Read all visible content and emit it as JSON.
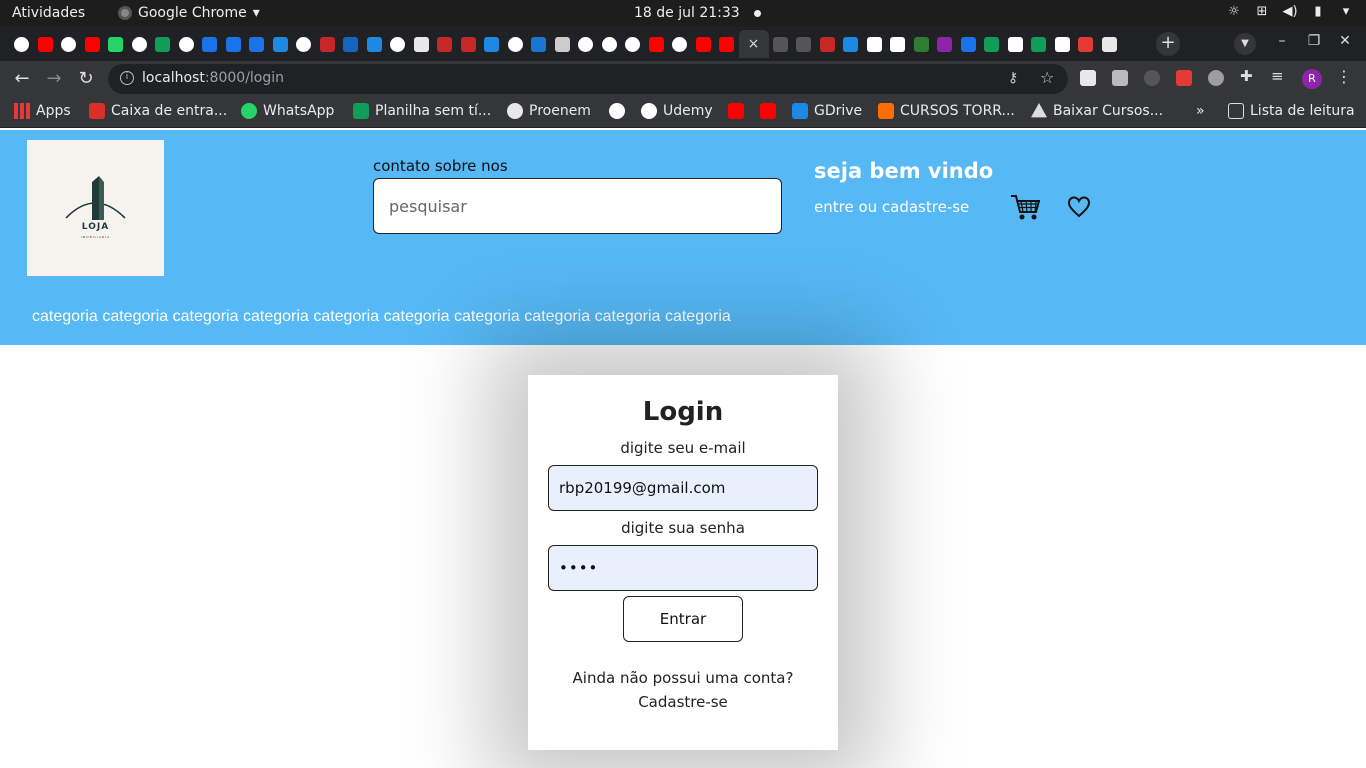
{
  "os": {
    "activities": "Atividades",
    "app_name": "Google Chrome",
    "app_arrow": "▾",
    "datetime": "18 de jul  21:33"
  },
  "browser": {
    "url_host": "localhost",
    "url_path": ":8000/login",
    "tab_close": "×",
    "bookmarks": {
      "apps": "Apps",
      "gmail": "Caixa de entra...",
      "whatsapp": "WhatsApp",
      "sheets": "Planilha sem tí...",
      "proenem": "Proenem",
      "udemy": "Udemy",
      "gdrive": "GDrive",
      "cursos": "CURSOS TORR...",
      "baixar": "Baixar Cursos...",
      "reading_list": "Lista de leitura"
    },
    "profile_initial": "R"
  },
  "site": {
    "logo_text": "LOJA",
    "logo_subtext": "IMOBILIÁRIA",
    "nav_links": "contato sobre nos",
    "search_placeholder": "pesquisar",
    "welcome": "seja bem vindo",
    "login_link": "entre ou cadastre-se",
    "categories": [
      "categoria",
      "categoria",
      "categoria",
      "categoria",
      "categoria",
      "categoria",
      "categoria",
      "categoria",
      "categoria",
      "categoria"
    ],
    "colors": {
      "header_bg": "#56b8f4",
      "input_autofill_bg": "#e8f0fe"
    }
  },
  "login": {
    "title": "Login",
    "email_label": "digite seu e-mail",
    "email_value": "rbp20199@gmail.com",
    "password_label": "digite sua senha",
    "password_value": "••••",
    "submit_label": "Entrar",
    "no_account": "Ainda não possui uma conta?",
    "signup_link": "Cadastre-se"
  }
}
